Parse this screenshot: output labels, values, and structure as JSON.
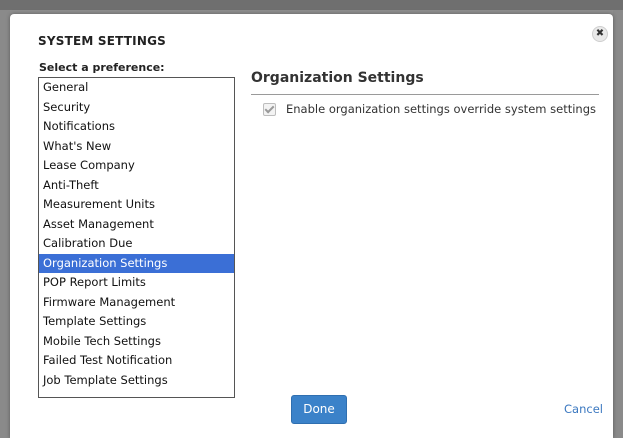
{
  "dialog": {
    "title": "SYSTEM SETTINGS",
    "close_glyph": "✖",
    "list_label": "Select a preference:",
    "preferences": [
      {
        "label": "General"
      },
      {
        "label": "Security"
      },
      {
        "label": "Notifications"
      },
      {
        "label": "What's New"
      },
      {
        "label": "Lease Company"
      },
      {
        "label": "Anti-Theft"
      },
      {
        "label": "Measurement Units"
      },
      {
        "label": "Asset Management"
      },
      {
        "label": "Calibration Due"
      },
      {
        "label": "Organization Settings",
        "selected": true
      },
      {
        "label": "POP Report Limits"
      },
      {
        "label": "Firmware Management"
      },
      {
        "label": "Template Settings"
      },
      {
        "label": "Mobile Tech Settings"
      },
      {
        "label": "Failed Test Notification"
      },
      {
        "label": "Job Template Settings"
      }
    ],
    "section_title": "Organization Settings",
    "option": {
      "label": "Enable organization settings override system settings",
      "checked": true
    },
    "done_label": "Done",
    "cancel_label": "Cancel"
  },
  "colors": {
    "selected_bg": "#3b6fd6",
    "done_bg": "#3b82c9",
    "cancel_link": "#3b78c0"
  }
}
